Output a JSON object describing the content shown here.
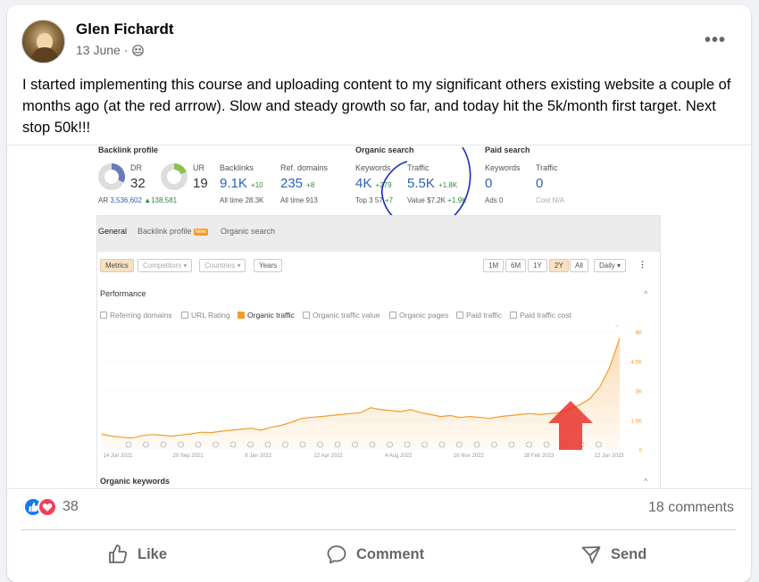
{
  "post": {
    "author": "Glen Fichardt",
    "date": "13 June",
    "date_separator": "·",
    "audience_icon": "friends-icon",
    "more_icon": "more-dots-icon",
    "text": "I started implementing this course and uploading content to my significant others existing website a couple of months ago (at the red arrrow). Slow and steady growth so far, and today hit the 5k/month first target. Next stop 50k!!!"
  },
  "screenshot": {
    "headers": {
      "backlink": "Backlink profile",
      "organic": "Organic search",
      "paid": "Paid search"
    },
    "dr": {
      "label": "DR",
      "value": "32",
      "ar_label": "AR",
      "ar_value": "3,536,602",
      "ar_change": "▲138,581"
    },
    "ur": {
      "label": "UR",
      "value": "19"
    },
    "backlinks": {
      "label": "Backlinks",
      "value": "9.1K",
      "change": "+10",
      "sub": "All time 28.3K"
    },
    "refdomains": {
      "label": "Ref. domains",
      "value": "235",
      "change": "+8",
      "sub": "All time 913"
    },
    "keywords": {
      "label": "Keywords",
      "value": "4K",
      "change": "+279",
      "sub": "Top 3",
      "sub_value": "57",
      "sub_change": "+7"
    },
    "traffic": {
      "label": "Traffic",
      "value": "5.5K",
      "change": "+1.8K",
      "sub": "Value",
      "sub_value": "$7.2K",
      "sub_change": "+1.9K"
    },
    "paid_keywords": {
      "label": "Keywords",
      "value": "0",
      "sub": "Ads 0"
    },
    "paid_traffic": {
      "label": "Traffic",
      "value": "0",
      "sub": "Cost N/A"
    },
    "tabs": [
      "General",
      "Backlink profile",
      "Organic search"
    ],
    "new_badge": "New",
    "controls_left": [
      "Metrics",
      "Competitors ▾",
      "Countries ▾",
      "Years"
    ],
    "controls_right": [
      "1M",
      "6M",
      "1Y",
      "2Y",
      "All",
      "Daily ▾"
    ],
    "kebab": "⋮",
    "performance": "Performance",
    "checkboxes": [
      {
        "label": "Referring domains",
        "checked": false
      },
      {
        "label": "URL Rating",
        "checked": false
      },
      {
        "label": "Organic traffic",
        "checked": true
      },
      {
        "label": "Organic traffic value",
        "checked": false
      },
      {
        "label": "Organic pages",
        "checked": false
      },
      {
        "label": "Paid traffic",
        "checked": false
      },
      {
        "label": "Paid traffic cost",
        "checked": false
      }
    ],
    "organic_keywords": "Organic keywords",
    "chevron": "^"
  },
  "chart_data": {
    "type": "area",
    "title": "",
    "series": [
      {
        "name": "Organic traffic",
        "color": "#f39c2a"
      }
    ],
    "x": [
      "14 Jun 2021",
      "20 Sep 2021",
      "8 Jan 2022",
      "22 Apr 2022",
      "4 Aug 2022",
      "16 Nov 2022",
      "28 Feb 2023",
      "12 Jun 2023"
    ],
    "y_ticks": [
      "0",
      "1.5K",
      "3K",
      "4.5K",
      "6K"
    ],
    "ylim": [
      0,
      6000
    ],
    "values": [
      800,
      700,
      650,
      600,
      720,
      780,
      750,
      700,
      760,
      820,
      900,
      880,
      950,
      1000,
      1050,
      1100,
      1000,
      1150,
      1250,
      1400,
      1600,
      1650,
      1700,
      1750,
      1800,
      1850,
      1900,
      2150,
      2050,
      2000,
      1950,
      2050,
      1900,
      1800,
      1700,
      1750,
      1650,
      1700,
      1650,
      1600,
      1700,
      1750,
      1800,
      1850,
      1800,
      1850,
      1900,
      2100,
      2300,
      2600,
      3200,
      4200,
      5700
    ],
    "annotation_icons": 28
  },
  "engagement": {
    "reactions_count": "38",
    "comments": "18 comments",
    "like_color": "#1877f2",
    "love_color": "#f33e58"
  },
  "actions": {
    "like": "Like",
    "comment": "Comment",
    "send": "Send"
  }
}
